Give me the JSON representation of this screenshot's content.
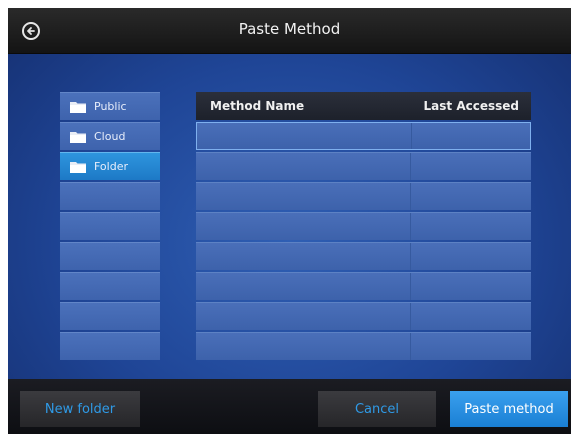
{
  "header": {
    "title": "Paste Method"
  },
  "sidebar": {
    "items": [
      {
        "label": "Public"
      },
      {
        "label": "Cloud"
      },
      {
        "label": "Folder"
      }
    ]
  },
  "table": {
    "columns": [
      "Method Name",
      "Last Accessed"
    ],
    "rows": []
  },
  "footer": {
    "new_folder": "New folder",
    "cancel": "Cancel",
    "paste": "Paste method"
  },
  "colors": {
    "accent": "#2f9ae6",
    "selected": "#1d79c6"
  }
}
